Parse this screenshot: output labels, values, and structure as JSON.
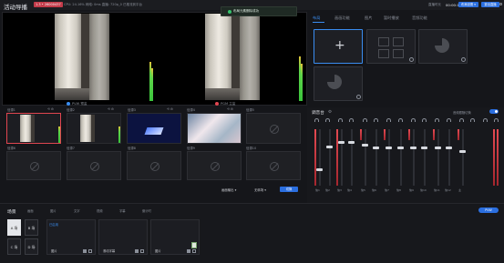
{
  "header": {
    "title": "活动导播",
    "badge": "1.3 • 26000437",
    "stats": "CPU: 24.16%   网络: 0ms   直播: 720p_0   已推流到平台",
    "toast": "布局元素删除成功",
    "time_label": "直播时长",
    "time": "00:00:17",
    "buttons": [
      "设置",
      "布局设置 ▾",
      "退出直播"
    ]
  },
  "preview": {
    "pvw_label": "PVW 预监",
    "pgm_label": "PGM 主监"
  },
  "sources": {
    "row1": [
      {
        "label": "信源1",
        "icons": "⟲  ⚙"
      },
      {
        "label": "信源2",
        "icons": "⟲  ⚙"
      },
      {
        "label": "信源3",
        "icons": "⟲  ⚙"
      },
      {
        "label": "信源4",
        "icons": "⟲  ⚙"
      },
      {
        "label": "信源5",
        "icons": ""
      }
    ],
    "row2": [
      "信源6",
      "信源7",
      "信源8",
      "信源9",
      "信源10"
    ],
    "colors": {
      "active": "#e04650",
      "accent": "#3a8df0"
    }
  },
  "source_toolbar": {
    "select1": "画面输出 ▾",
    "select2": "无转场 ▾",
    "switch_button": "切换"
  },
  "layout_panel": {
    "tabs": [
      "布局",
      "画画功能",
      "图片",
      "暂时播放",
      "音频功能"
    ],
    "add_icon": "+"
  },
  "mixer": {
    "title": "调音台",
    "settings_icon": "⚙",
    "follow_label": "音频跟随切换",
    "channel_labels": [
      "信1",
      "信2",
      "信3",
      "信4",
      "信5",
      "信6",
      "信7",
      "信8",
      "信9",
      "信10",
      "信11",
      "信12",
      "主"
    ]
  },
  "bottom": {
    "title": "场景",
    "toolbar": [
      "画面",
      "图片",
      "文字",
      "视频",
      "字幕",
      "倒计时"
    ],
    "scenes": [
      "A 场",
      "B 场",
      "C 场",
      "D 场"
    ],
    "clips": [
      {
        "name": "图片",
        "tag": "已启用"
      },
      {
        "name": "滚动字幕",
        "tag": ""
      },
      {
        "name": "图片",
        "tag": ""
      }
    ],
    "pvw_button": "PVW"
  }
}
